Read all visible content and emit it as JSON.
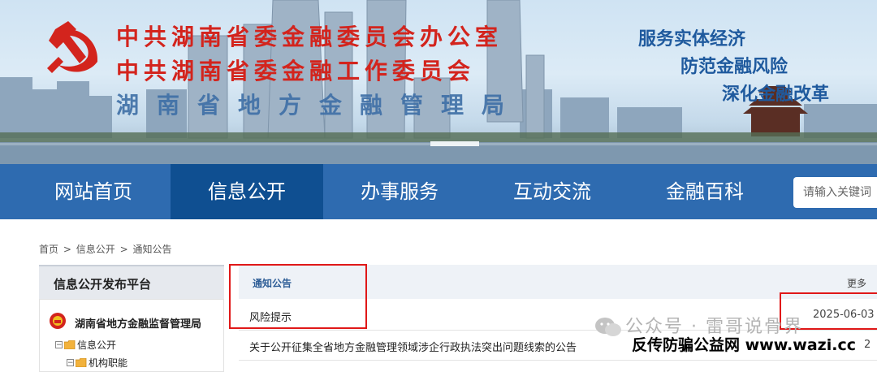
{
  "banner": {
    "title_line1": "中共湖南省委金融委员会办公室",
    "title_line2": "中共湖南省委金融工作委员会",
    "title_line3": "湖南省地方金融管理局",
    "slogans": [
      "服务实体经济",
      "防范金融风险",
      "深化金融改革"
    ]
  },
  "nav": {
    "items": [
      "网站首页",
      "信息公开",
      "办事服务",
      "互动交流",
      "金融百科"
    ],
    "active": "信息公开",
    "search_placeholder": "请输入关键词"
  },
  "breadcrumb": [
    "首页",
    ">",
    "信息公开",
    ">",
    "通知公告"
  ],
  "sidebar": {
    "title": "信息公开发布平台",
    "org_name": "湖南省地方金融监督管理局",
    "tree": [
      "信息公开",
      "机构职能"
    ]
  },
  "list": {
    "header": "通知公告",
    "more": "更多",
    "items": [
      {
        "title": "风险提示",
        "date": "2025-06-03"
      },
      {
        "title": "关于公开征集全省地方金融管理领域涉企行政执法突出问题线索的公告",
        "date": "2"
      }
    ]
  },
  "watermark": {
    "wechat_text": "公众号 · 雷哥说骨界",
    "site_text": "反传防骗公益网 www.wazi.cc",
    "tail_text": "公众号 · 雷哥说"
  },
  "colors": {
    "banner_red": "#d3241d",
    "nav_blue": "#2e6bb0",
    "nav_active": "#0f4f91",
    "highlight_red": "#e01818"
  }
}
